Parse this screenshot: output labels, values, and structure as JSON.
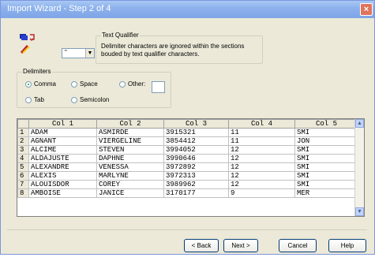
{
  "window": {
    "title": "Import Wizard - Step 2 of 4",
    "close": "×"
  },
  "qualifier": {
    "value": "\"",
    "group_label": "Text Qualifier",
    "description_line1": "Delimiter characters are ignored within the sections",
    "description_line2": "bouded by text qualifier characters."
  },
  "delimiters": {
    "group_label": "Delimiters",
    "options": [
      {
        "label": "Comma",
        "selected": true
      },
      {
        "label": "Space",
        "selected": false
      },
      {
        "label": "Other:",
        "selected": false
      },
      {
        "label": "Tab",
        "selected": false
      },
      {
        "label": "Semicolon",
        "selected": false
      }
    ],
    "other_value": ""
  },
  "grid": {
    "columns": [
      "Col 1",
      "Col 2",
      "Col 3",
      "Col 4",
      "Col 5"
    ],
    "rows": [
      {
        "n": "1",
        "cells": [
          "ADAM",
          "ASMIRDE",
          "3915321",
          "11",
          "SMI"
        ]
      },
      {
        "n": "2",
        "cells": [
          "AGNANT",
          "VIERGELINE",
          "3854412",
          "11",
          "JON"
        ]
      },
      {
        "n": "3",
        "cells": [
          "ALCIME",
          "STEVEN",
          "3994052",
          "12",
          "SMI"
        ]
      },
      {
        "n": "4",
        "cells": [
          "ALDAJUSTE",
          "DAPHNE",
          "3990646",
          "12",
          "SMI"
        ]
      },
      {
        "n": "5",
        "cells": [
          "ALEXANDRE",
          "VENESSA",
          "3972892",
          "12",
          "SMI"
        ]
      },
      {
        "n": "6",
        "cells": [
          "ALEXIS",
          "MARLYNE",
          "3972313",
          "12",
          "SMI"
        ]
      },
      {
        "n": "7",
        "cells": [
          "ALOUISDOR",
          "COREY",
          "3989962",
          "12",
          "SMI"
        ]
      },
      {
        "n": "8",
        "cells": [
          "AMBOISE",
          "JANICE",
          "3170177",
          "9",
          "MER"
        ]
      }
    ]
  },
  "buttons": {
    "back": "< Back",
    "next": "Next >",
    "cancel": "Cancel",
    "help": "Help"
  },
  "colors": {
    "title_bar": "#8DB2EC",
    "dialog_bg": "#ECE9D8",
    "close_button": "#E0745C"
  }
}
